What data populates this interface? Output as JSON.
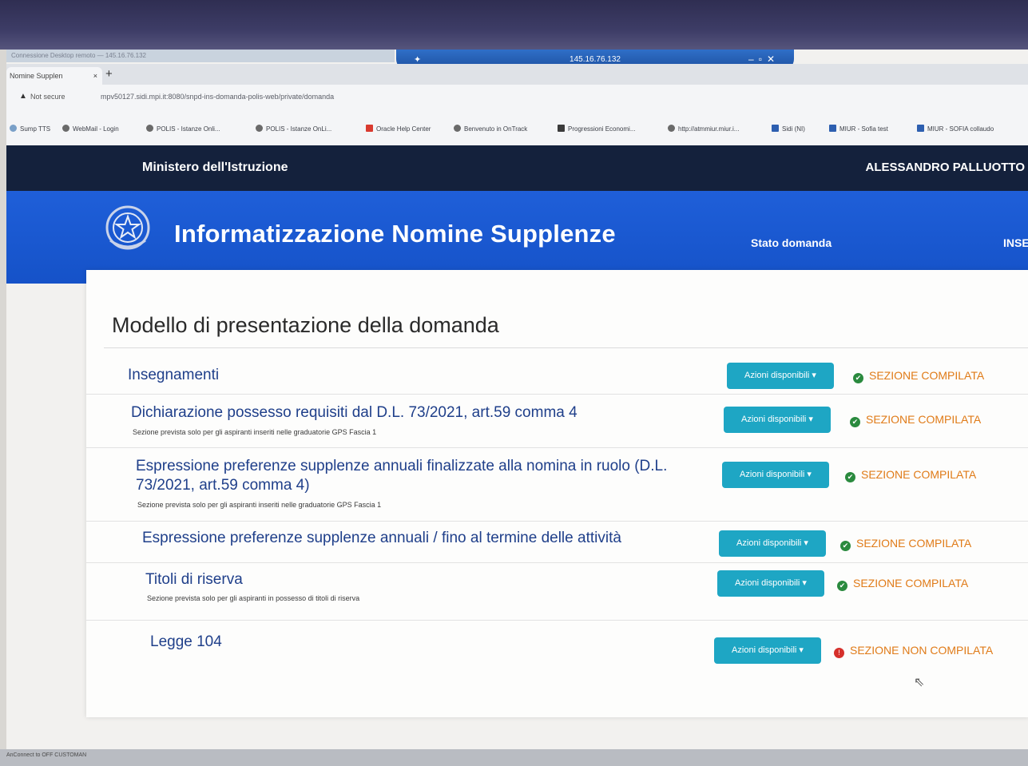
{
  "remote_bar": {
    "ip": "145.16.76.132",
    "title_strip": "Connessione Desktop remoto — 145.16.76.132"
  },
  "browser": {
    "tab_title": "Nomine Supplen",
    "tab_close": "×",
    "new_tab": "+",
    "not_secure": "Not secure",
    "url": "mpv50127.sidi.mpi.it:8080/snpd-ins-domanda-polis-web/private/domanda",
    "bookmarks": [
      "Sump TTS",
      "WebMail - Login",
      "POLIS - Istanze Onli...",
      "POLIS - Istanze OnLi...",
      "Oracle Help Center",
      "Benvenuto in OnTrack",
      "Progressioni Economi...",
      "http://atmmiur.miur.i...",
      "Sidi (NI)",
      "MIUR - Sofia test",
      "MIUR - SOFIA collaudo"
    ]
  },
  "site": {
    "ministry": "Ministero dell'Istruzione",
    "user": "ALESSANDRO PALLUOTTO",
    "app_title": "Informatizzazione Nomine Supplenze",
    "nav_stato": "Stato domanda",
    "nav_inse": "INSE"
  },
  "main": {
    "title": "Modello di presentazione della domanda",
    "button_label": "Azioni disponibili ▾",
    "rows": [
      {
        "title": "Insegnamenti",
        "subtitle": "",
        "status": "SEZIONE COMPILATA"
      },
      {
        "title": "Dichiarazione possesso requisiti dal D.L. 73/2021, art.59 comma 4",
        "subtitle": "Sezione prevista solo per gli aspiranti inseriti nelle graduatorie GPS Fascia 1",
        "status": "SEZIONE COMPILATA"
      },
      {
        "title": "Espressione preferenze supplenze annuali finalizzate alla nomina in ruolo (D.L. 73/2021, art.59 comma 4)",
        "subtitle": "Sezione prevista solo per gli aspiranti inseriti nelle graduatorie GPS Fascia 1",
        "status": "SEZIONE COMPILATA"
      },
      {
        "title": "Espressione preferenze supplenze annuali / fino al termine delle attività",
        "subtitle": "",
        "status": "SEZIONE COMPILATA"
      },
      {
        "title": "Titoli di riserva",
        "subtitle": "Sezione prevista solo per gli aspiranti in possesso di titoli di riserva",
        "status": "SEZIONE COMPILATA"
      },
      {
        "title": "Legge 104",
        "subtitle": "",
        "status": "SEZIONE NON COMPILATA"
      }
    ]
  },
  "status_icons": {
    "ok": "✔",
    "ko": "!"
  },
  "colors": {
    "header_dark": "#14213c",
    "header_blue": "#1f5fd9",
    "button": "#1ea6c4",
    "status_text": "#e07b18",
    "ok_icon": "#2a8a3e",
    "ko_icon": "#d6302b",
    "row_title": "#1f3f8a"
  },
  "taskbar": {
    "text": "AnConnect to OFF   CUSTOMAN"
  }
}
